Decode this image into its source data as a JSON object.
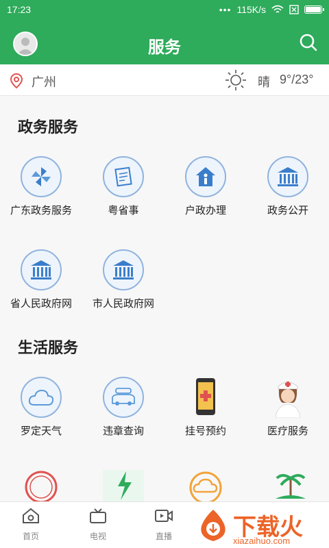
{
  "status_bar": {
    "time": "17:23",
    "dots": "•••",
    "network_speed": "115K/s",
    "wifi": "wifi-icon",
    "sim": "sim-off-icon",
    "battery": "battery-icon"
  },
  "app_bar": {
    "title": "服务",
    "avatar": "avatar-icon",
    "search": "search-icon"
  },
  "location_bar": {
    "city": "广州",
    "weather": "晴",
    "temperature": "9°/23°",
    "location_icon": "location-pin-icon",
    "weather_icon": "sun-icon"
  },
  "sections": {
    "gov": {
      "title": "政务服务"
    },
    "life": {
      "title": "生活服务"
    }
  },
  "gov_items": [
    {
      "label": "广东政务服务",
      "icon": "pinwheel-icon"
    },
    {
      "label": "粤省事",
      "icon": "document-icon"
    },
    {
      "label": "户政办理",
      "icon": "house-person-icon"
    },
    {
      "label": "政务公开",
      "icon": "government-building-icon"
    },
    {
      "label": "省人民政府网",
      "icon": "government-building-icon"
    },
    {
      "label": "市人民政府网",
      "icon": "government-building-icon"
    }
  ],
  "life_items": [
    {
      "label": "罗定天气",
      "icon": "cloud-icon"
    },
    {
      "label": "违章查询",
      "icon": "car-icon"
    },
    {
      "label": "挂号预约",
      "icon": "phone-medical-icon"
    },
    {
      "label": "医疗服务",
      "icon": "nurse-icon"
    }
  ],
  "tabs": [
    {
      "label": "首页",
      "icon": "home-icon"
    },
    {
      "label": "电视",
      "icon": "tv-icon"
    },
    {
      "label": "直播",
      "icon": "video-icon"
    }
  ],
  "watermark": {
    "text": "下载火",
    "sub": "xiazaihuo.com"
  },
  "colors": {
    "brand_green": "#2eab5b",
    "icon_blue": "#8fb3de",
    "watermark_orange": "#ec6428"
  }
}
